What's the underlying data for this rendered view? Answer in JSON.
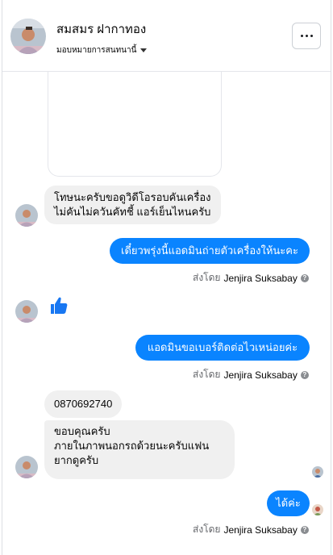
{
  "header": {
    "name": "สมสมร ฝากาทอง",
    "assign_label": "มอบหมายการสนทนานี้",
    "more_label": "More options"
  },
  "colors": {
    "outgoing_bubble": "#0a84ff",
    "incoming_bubble": "#f0f0f0",
    "like_icon": "#1877f2"
  },
  "messages": [
    {
      "direction": "in",
      "type": "image"
    },
    {
      "direction": "in",
      "lines": [
        "โทษนะครับขอดูวิดีโอรอบคันเครื่อง",
        "ไม่คันไม่ควันคัทชี้ แอร์เย็นไหนครับ"
      ]
    },
    {
      "direction": "out",
      "text": "เดี๋ยวพรุ่งนี้แอดมินถ่ายตัวเครื่องให้นะคะ",
      "sent_by_prefix": "ส่งโดย",
      "sent_by": "Jenjira Suksabay"
    },
    {
      "direction": "in",
      "type": "like",
      "icon": "thumbs-up-icon"
    },
    {
      "direction": "out",
      "text": "แอดมินขอเบอร์ติดต่อไวเหน่อยค่ะ",
      "sent_by_prefix": "ส่งโดย",
      "sent_by": "Jenjira Suksabay"
    },
    {
      "direction": "in",
      "text": "0870692740"
    },
    {
      "direction": "in",
      "lines": [
        "ขอบคุณครับ",
        "ภายในภาพนอกรถด้วยนะครับแฟน",
        "ยากดูครับ"
      ]
    },
    {
      "direction": "out",
      "text": "ได้ค่ะ",
      "sent_by_prefix": "ส่งโดย",
      "sent_by": "Jenjira Suksabay"
    }
  ]
}
